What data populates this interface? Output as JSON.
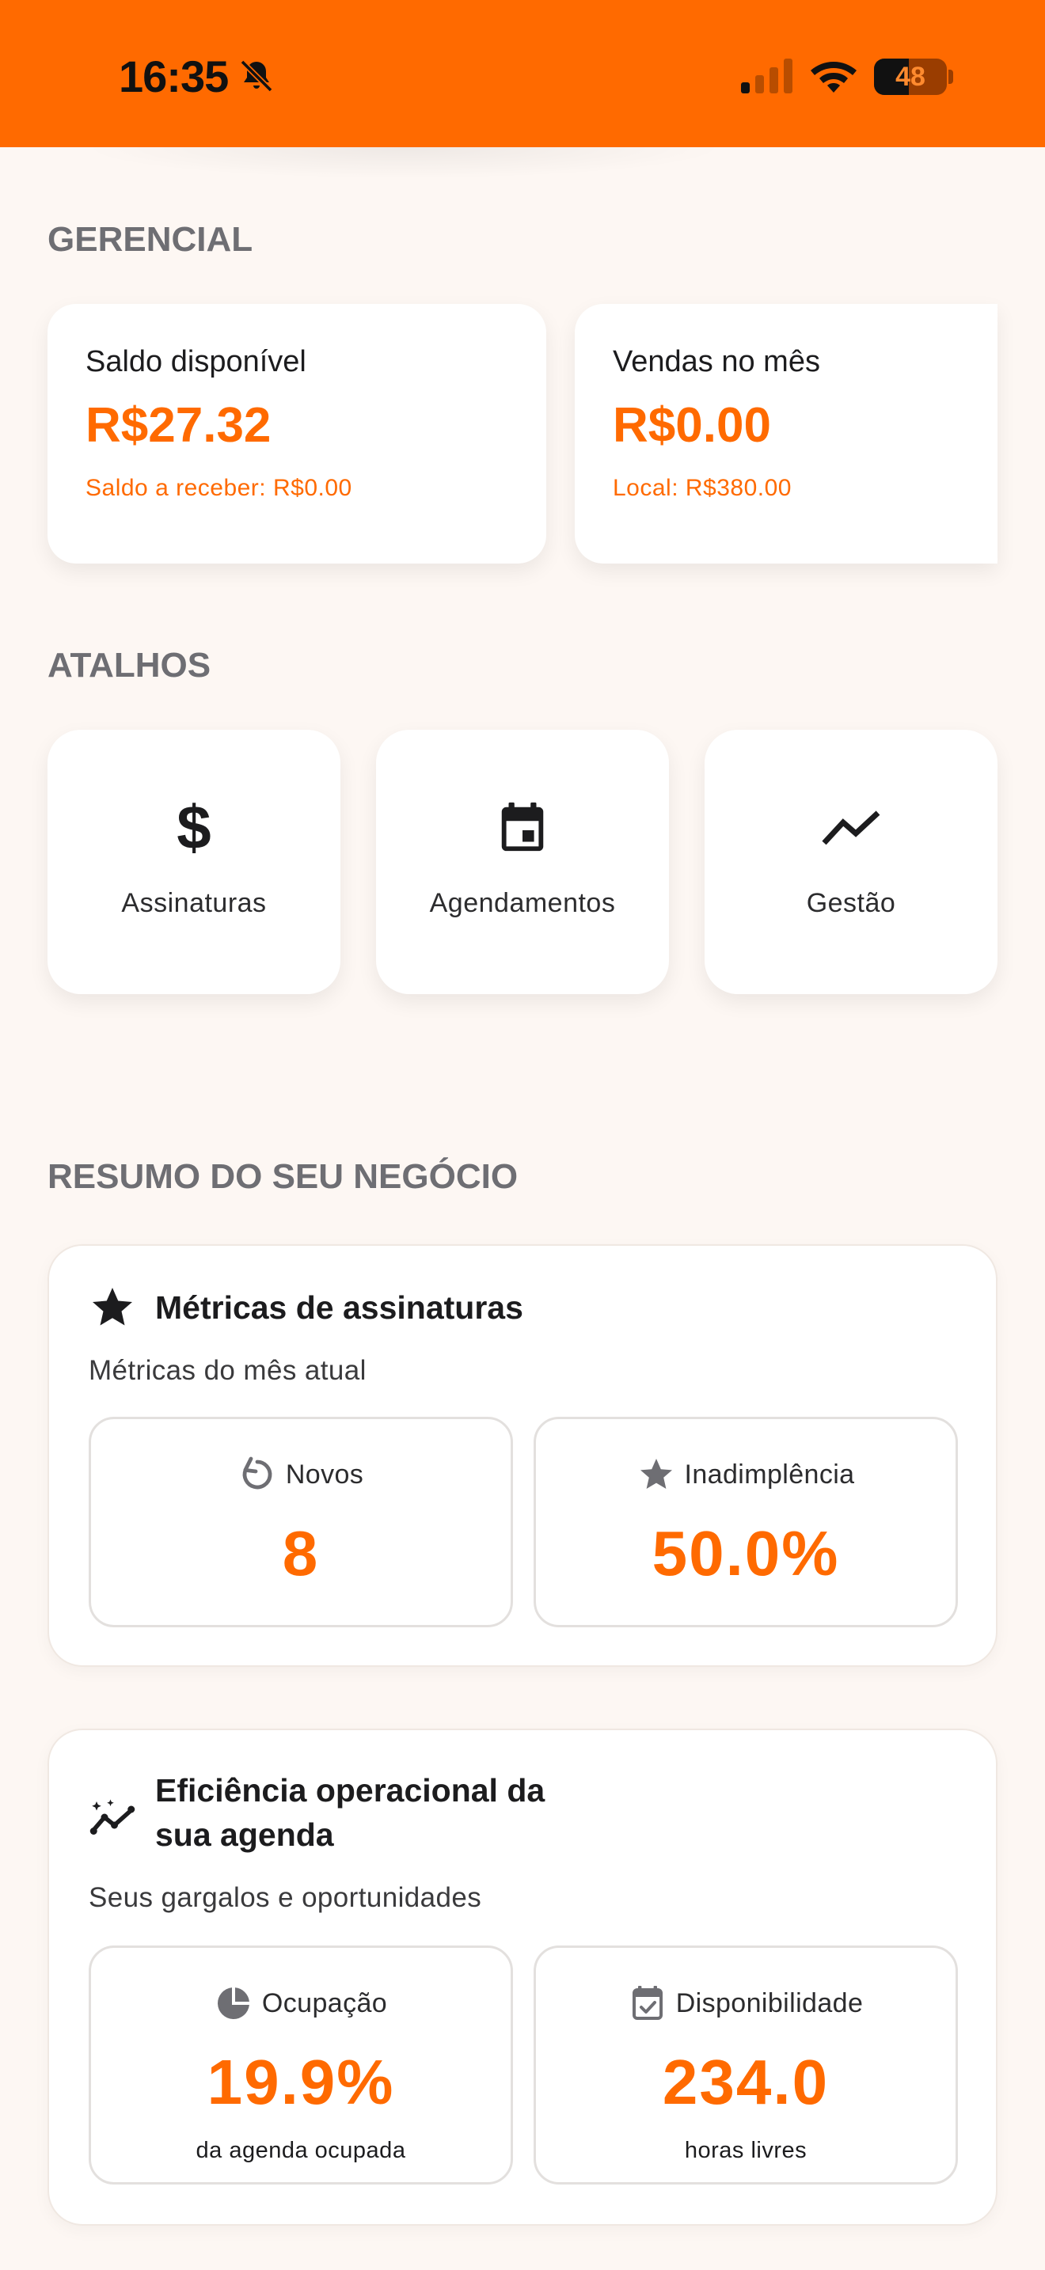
{
  "status_bar": {
    "time": "16:35",
    "battery_level": "48",
    "bell_icon": "bell-slash-icon",
    "signal_icon": "cellular-signal-icon",
    "wifi_icon": "wifi-icon"
  },
  "colors": {
    "accent": "#FF6A00",
    "background": "#FDF7F3",
    "section_title": "#6E6E73"
  },
  "gerencial": {
    "title": "GERENCIAL",
    "cards": [
      {
        "label": "Saldo disponível",
        "value": "R$27.32",
        "sub": "Saldo a receber: R$0.00"
      },
      {
        "label": "Vendas no mês",
        "value": "R$0.00",
        "sub": "Local: R$380.00"
      }
    ]
  },
  "atalhos": {
    "title": "ATALHOS",
    "items": [
      {
        "label": "Assinaturas",
        "icon": "dollar-icon"
      },
      {
        "label": "Agendamentos",
        "icon": "calendar-icon"
      },
      {
        "label": "Gestão",
        "icon": "trending-up-icon"
      }
    ]
  },
  "resumo": {
    "title": "RESUMO DO SEU NEGÓCIO",
    "assinaturas": {
      "icon": "star-icon",
      "title": "Métricas de assinaturas",
      "subtitle": "Métricas do mês atual",
      "tiles": [
        {
          "icon": "refresh-icon",
          "label": "Novos",
          "value": "8"
        },
        {
          "icon": "star-icon",
          "label": "Inadimplência",
          "value": "50.0%"
        }
      ]
    },
    "eficiencia": {
      "icon": "sparkline-icon",
      "title_line1": "Eficiência operacional da",
      "title_line2": "sua agenda",
      "subtitle": "Seus gargalos e oportunidades",
      "tiles": [
        {
          "icon": "pie-chart-icon",
          "label": "Ocupação",
          "value": "19.9%",
          "caption": "da agenda ocupada"
        },
        {
          "icon": "calendar-check-icon",
          "label": "Disponibilidade",
          "value": "234.0",
          "caption": "horas livres"
        }
      ]
    }
  }
}
